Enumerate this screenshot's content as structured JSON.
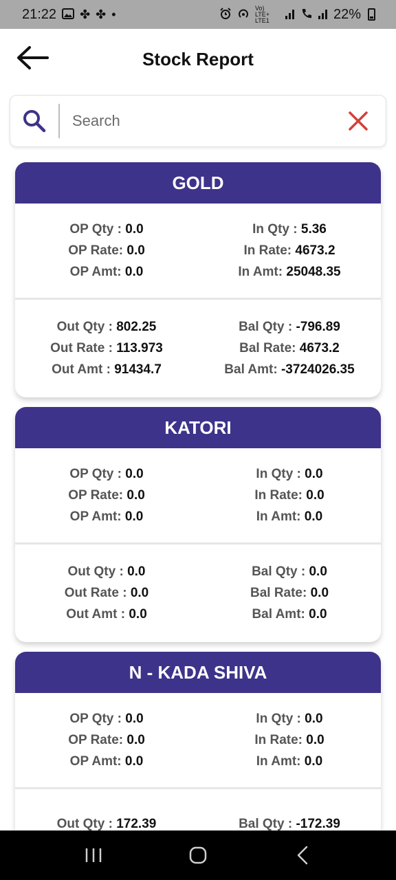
{
  "status_bar": {
    "time": "21:22",
    "battery": "22%",
    "icons_left": [
      "gallery-icon",
      "fan-icon",
      "fan-icon",
      "dot-icon"
    ],
    "icons_right": [
      "alarm-icon",
      "hotspot-icon",
      "volte-icon",
      "signal-icon",
      "wifi-calling-icon",
      "signal-icon",
      "battery-icon"
    ],
    "volte_label": "Vo) LTE+ LTE1"
  },
  "header": {
    "title": "Stock Report",
    "back_icon": "arrow-left-icon"
  },
  "search": {
    "placeholder": "Search",
    "value": "",
    "search_icon_color": "#3d338a",
    "clear_icon_color": "#d0413a"
  },
  "theme": {
    "accent": "#3d338a"
  },
  "items": [
    {
      "name": "GOLD",
      "op_qty": "0.0",
      "op_rate": "0.0",
      "op_amt": "0.0",
      "in_qty": "5.36",
      "in_rate": "4673.2",
      "in_amt": "25048.35",
      "out_qty": "802.25",
      "out_rate": "113.973",
      "out_amt": "91434.7",
      "bal_qty": "-796.89",
      "bal_rate": "4673.2",
      "bal_amt": "-3724026.35"
    },
    {
      "name": "KATORI",
      "op_qty": "0.0",
      "op_rate": "0.0",
      "op_amt": "0.0",
      "in_qty": "0.0",
      "in_rate": "0.0",
      "in_amt": "0.0",
      "out_qty": "0.0",
      "out_rate": "0.0",
      "out_amt": "0.0",
      "bal_qty": "0.0",
      "bal_rate": "0.0",
      "bal_amt": "0.0"
    },
    {
      "name": "N - KADA SHIVA",
      "op_qty": "0.0",
      "op_rate": "0.0",
      "op_amt": "0.0",
      "in_qty": "0.0",
      "in_rate": "0.0",
      "in_amt": "0.0",
      "out_qty": "172.39",
      "bal_qty": "-172.39"
    }
  ],
  "labels": {
    "op_qty": "OP Qty : ",
    "op_rate": "OP Rate: ",
    "op_amt": "OP Amt: ",
    "in_qty": "In Qty : ",
    "in_rate": "In Rate: ",
    "in_amt": "In Amt: ",
    "out_qty": "Out Qty : ",
    "out_rate": "Out Rate : ",
    "out_amt": "Out Amt : ",
    "bal_qty": "Bal Qty : ",
    "bal_rate": "Bal Rate: ",
    "bal_amt": "Bal Amt: "
  },
  "nav": {
    "buttons": [
      "recents-icon",
      "home-icon",
      "back-icon"
    ]
  }
}
